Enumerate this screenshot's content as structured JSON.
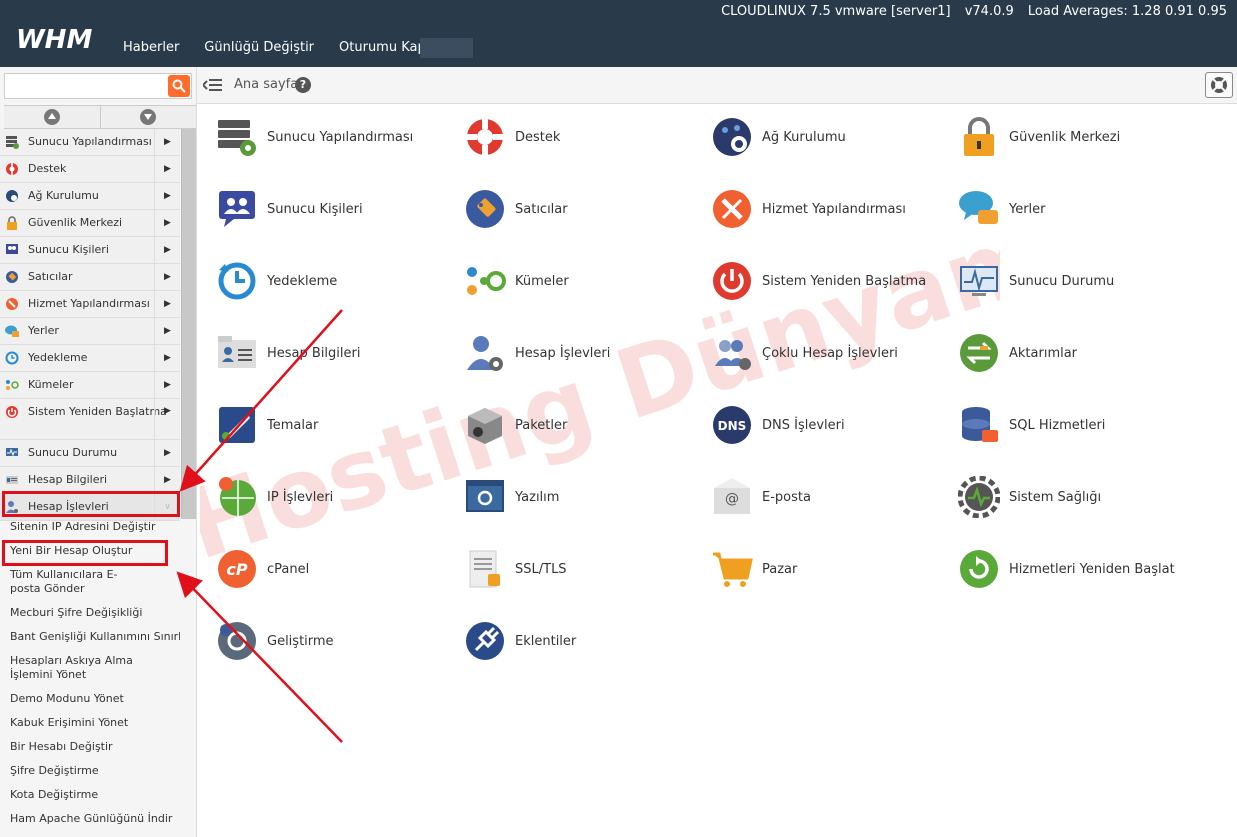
{
  "header": {
    "server_name": "CLOUDLINUX 7.5 vmware [server1]",
    "version": "v74.0.9",
    "load_averages": "Load Averages: 1.28 0.91 0.95",
    "logo_text": "WHM",
    "nav": [
      "Haberler",
      "Günlüğü Değiştir",
      "Oturumu Kapat"
    ]
  },
  "search": {
    "placeholder": ""
  },
  "breadcrumb": {
    "label": "Ana sayfa",
    "help": "?"
  },
  "sidebar": {
    "items": [
      {
        "label": "Sunucu Yapılandırması",
        "icon": "server-config-icon"
      },
      {
        "label": "Destek",
        "icon": "lifebuoy-icon"
      },
      {
        "label": "Ağ Kurulumu",
        "icon": "network-icon"
      },
      {
        "label": "Güvenlik Merkezi",
        "icon": "lock-icon"
      },
      {
        "label": "Sunucu Kişileri",
        "icon": "contacts-icon"
      },
      {
        "label": "Satıcılar",
        "icon": "tag-icon"
      },
      {
        "label": "Hizmet Yapılandırması",
        "icon": "tools-icon"
      },
      {
        "label": "Yerler",
        "icon": "speech-icon"
      },
      {
        "label": "Yedekleme",
        "icon": "backup-icon"
      },
      {
        "label": "Kümeler",
        "icon": "cluster-icon"
      },
      {
        "label": "Sistem Yeniden Başlatma",
        "icon": "power-icon"
      },
      {
        "label": "Sunucu Durumu",
        "icon": "monitor-icon"
      },
      {
        "label": "Hesap Bilgileri",
        "icon": "account-info-icon"
      },
      {
        "label": "Hesap İşlevleri",
        "icon": "account-functions-icon"
      }
    ],
    "submenu": [
      "Sitenin IP Adresini Değiştir",
      "Yeni Bir Hesap Oluştur",
      "Tüm Kullanıcılara E-posta Gönder",
      "Mecburi Şifre Değişikliği",
      "Bant Genişliği Kullanımını Sınırla",
      "Hesapları Askıya Alma İşlemini Yönet",
      "Demo Modunu Yönet",
      "Kabuk Erişimini Yönet",
      "Bir Hesabı Değiştir",
      "Şifre Değiştirme",
      "Kota Değiştirme",
      "Ham Apache Günlüğünü İndir"
    ]
  },
  "tiles": [
    {
      "label": "Sunucu Yapılandırması",
      "icon": "server-config-icon"
    },
    {
      "label": "Destek",
      "icon": "lifebuoy-icon"
    },
    {
      "label": "Ağ Kurulumu",
      "icon": "network-icon"
    },
    {
      "label": "Güvenlik Merkezi",
      "icon": "lock-icon"
    },
    {
      "label": "Sunucu Kişileri",
      "icon": "contacts-icon"
    },
    {
      "label": "Satıcılar",
      "icon": "tag-icon"
    },
    {
      "label": "Hizmet Yapılandırması",
      "icon": "tools-icon"
    },
    {
      "label": "Yerler",
      "icon": "speech-icon"
    },
    {
      "label": "Yedekleme",
      "icon": "backup-icon"
    },
    {
      "label": "Kümeler",
      "icon": "cluster-icon"
    },
    {
      "label": "Sistem Yeniden Başlatma",
      "icon": "power-icon"
    },
    {
      "label": "Sunucu Durumu",
      "icon": "monitor-icon"
    },
    {
      "label": "Hesap Bilgileri",
      "icon": "account-info-icon"
    },
    {
      "label": "Hesap İşlevleri",
      "icon": "account-functions-icon"
    },
    {
      "label": "Çoklu Hesap İşlevleri",
      "icon": "multi-account-icon"
    },
    {
      "label": "Aktarımlar",
      "icon": "transfer-icon"
    },
    {
      "label": "Temalar",
      "icon": "theme-icon"
    },
    {
      "label": "Paketler",
      "icon": "package-icon"
    },
    {
      "label": "DNS İşlevleri",
      "icon": "dns-icon"
    },
    {
      "label": "SQL Hizmetleri",
      "icon": "database-icon"
    },
    {
      "label": "IP İşlevleri",
      "icon": "ip-icon"
    },
    {
      "label": "Yazılım",
      "icon": "software-icon"
    },
    {
      "label": "E-posta",
      "icon": "email-icon"
    },
    {
      "label": "Sistem Sağlığı",
      "icon": "system-health-icon"
    },
    {
      "label": "cPanel",
      "icon": "cpanel-icon"
    },
    {
      "label": "SSL/TLS",
      "icon": "certificate-icon"
    },
    {
      "label": "Pazar",
      "icon": "cart-icon"
    },
    {
      "label": "Hizmetleri Yeniden Başlat",
      "icon": "restart-icon"
    },
    {
      "label": "Geliştirme",
      "icon": "development-icon"
    },
    {
      "label": "Eklentiler",
      "icon": "plugin-icon"
    }
  ],
  "watermark_text": "Hosting Dünyam",
  "colors": {
    "topbar": "#293a4a",
    "accent": "#ff6c2c",
    "annotation": "#e0101a"
  }
}
